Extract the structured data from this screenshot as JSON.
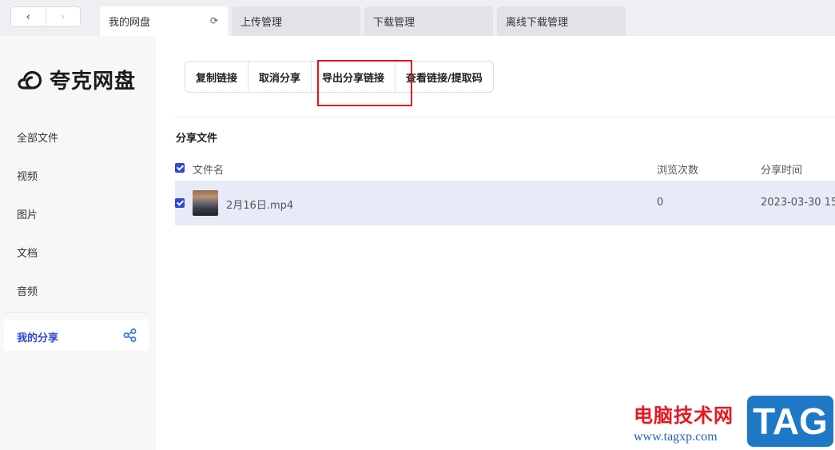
{
  "nav": {
    "back_icon": "chevron-left-icon",
    "forward_icon": "chevron-right-icon",
    "back": "‹",
    "forward": "›"
  },
  "tabs": [
    {
      "label": "我的网盘",
      "refresh": "⟳"
    },
    {
      "label": "上传管理"
    },
    {
      "label": "下载管理"
    },
    {
      "label": "离线下载管理"
    }
  ],
  "sidebar": {
    "logo_text": "夸克网盘",
    "items": [
      {
        "label": "全部文件"
      },
      {
        "label": "视频"
      },
      {
        "label": "图片"
      },
      {
        "label": "文档"
      },
      {
        "label": "音频"
      }
    ],
    "active_item": {
      "label": "我的分享",
      "icon": "share-icon"
    }
  },
  "toolbar": {
    "buttons": [
      {
        "label": "复制链接"
      },
      {
        "label": "取消分享"
      },
      {
        "label": "导出分享链接"
      },
      {
        "label": "查看链接/提取码"
      }
    ]
  },
  "section_title": "分享文件",
  "table": {
    "columns": [
      "文件名",
      "浏览次数",
      "分享时间"
    ],
    "rows": [
      {
        "name": "2月16日.mp4",
        "views": "0",
        "time": "2023-03-30 15:",
        "checked": true
      }
    ]
  },
  "watermark": {
    "cn": "电脑技术网",
    "url": "www.tagxp.com",
    "tag": "TAG"
  },
  "colors": {
    "accent": "#2f48d8",
    "highlight": "#e0141e",
    "selected_row": "#e8eaf8"
  }
}
